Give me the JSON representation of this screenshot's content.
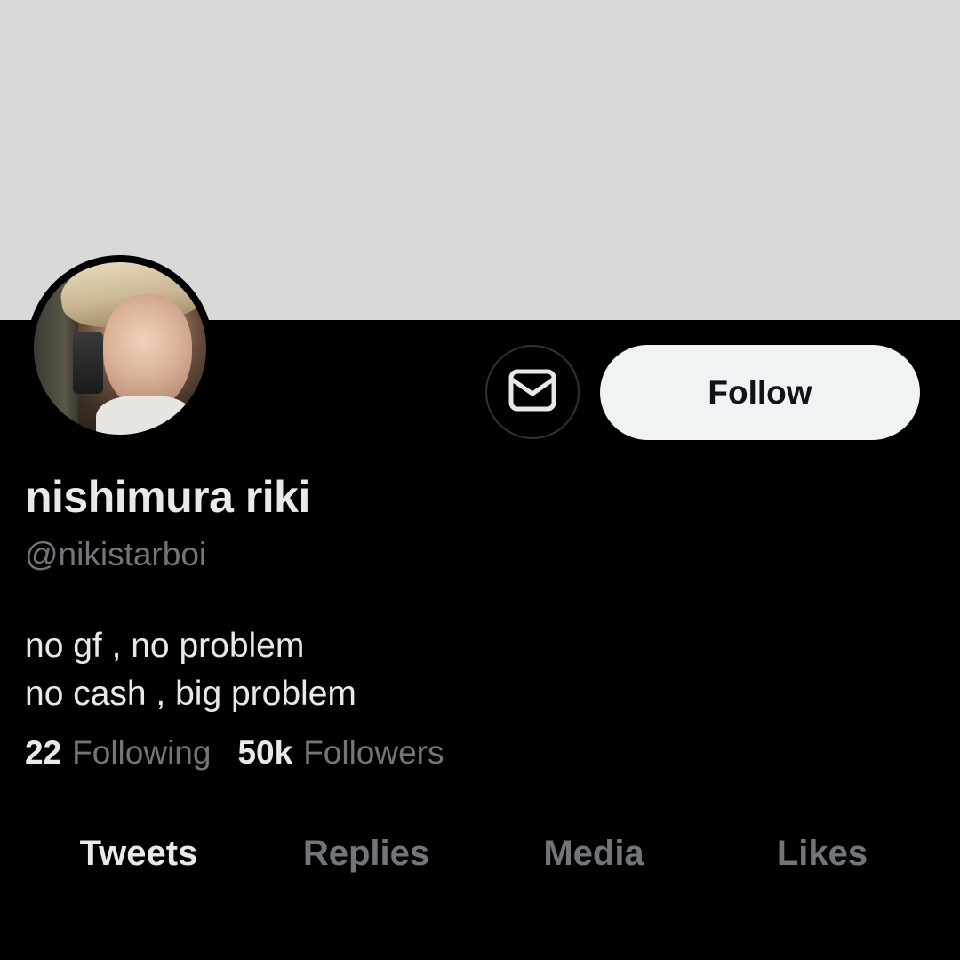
{
  "profile": {
    "display_name": "nishimura riki",
    "handle": "@nikistarboi",
    "bio_lines": [
      "no gf , no problem",
      "no cash , big problem"
    ]
  },
  "actions": {
    "message_icon": "envelope-icon",
    "follow_label": "Follow"
  },
  "stats": {
    "following_count": "22",
    "following_label": "Following",
    "followers_count": "50k",
    "followers_label": "Followers"
  },
  "tabs": [
    {
      "label": "Tweets",
      "active": true
    },
    {
      "label": "Replies",
      "active": false
    },
    {
      "label": "Media",
      "active": false
    },
    {
      "label": "Likes",
      "active": false
    }
  ],
  "colors": {
    "background": "#000000",
    "banner": "#d9d9d9",
    "primary_text": "#e7e9ea",
    "secondary_text": "#71767b",
    "follow_button_bg": "#eff3f4",
    "border": "#2f3336"
  }
}
